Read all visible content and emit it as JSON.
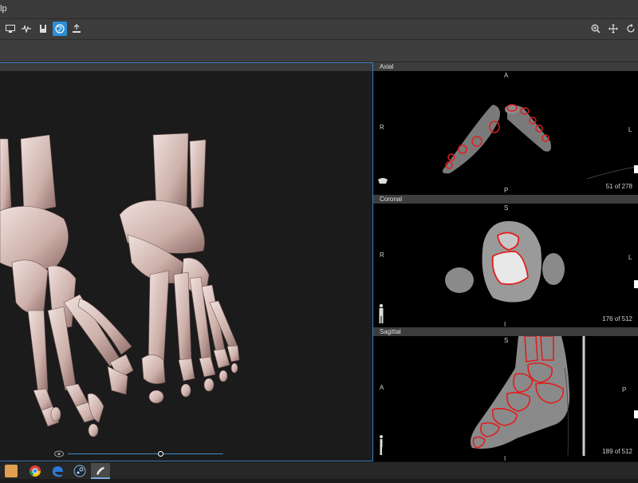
{
  "menubar": {
    "text": "lp"
  },
  "toolbar": {
    "left_icons": [
      "monitor-icon",
      "waveform-icon",
      "bucket-icon",
      "globe-icon",
      "export-icon"
    ],
    "right_icons": [
      "zoom-icon",
      "pan-icon",
      "rotate-icon"
    ],
    "active_icon": "globe-icon",
    "accent": "#2d8fd6"
  },
  "volume_view": {
    "slider_value": 0.6
  },
  "views": {
    "axial": {
      "title": "Axial",
      "top": "A",
      "bottom": "P",
      "left": "R",
      "right": "L",
      "count": "51 of 278"
    },
    "coronal": {
      "title": "Coronal",
      "top": "S",
      "bottom": "I",
      "left": "R",
      "right": "L",
      "count": "176 of 512"
    },
    "sagittal": {
      "title": "Sagittal",
      "top": "S",
      "bottom": "I",
      "left": "A",
      "right": "P",
      "count": "189 of 512"
    }
  },
  "colors": {
    "contour": "#e01e1e",
    "panel_border": "#3b7dbd",
    "bone": "#d8c4c0"
  },
  "taskbar": {
    "icons": [
      "app-icon",
      "chrome-icon",
      "edge-icon",
      "steam-icon",
      "pinned-app-icon"
    ]
  }
}
